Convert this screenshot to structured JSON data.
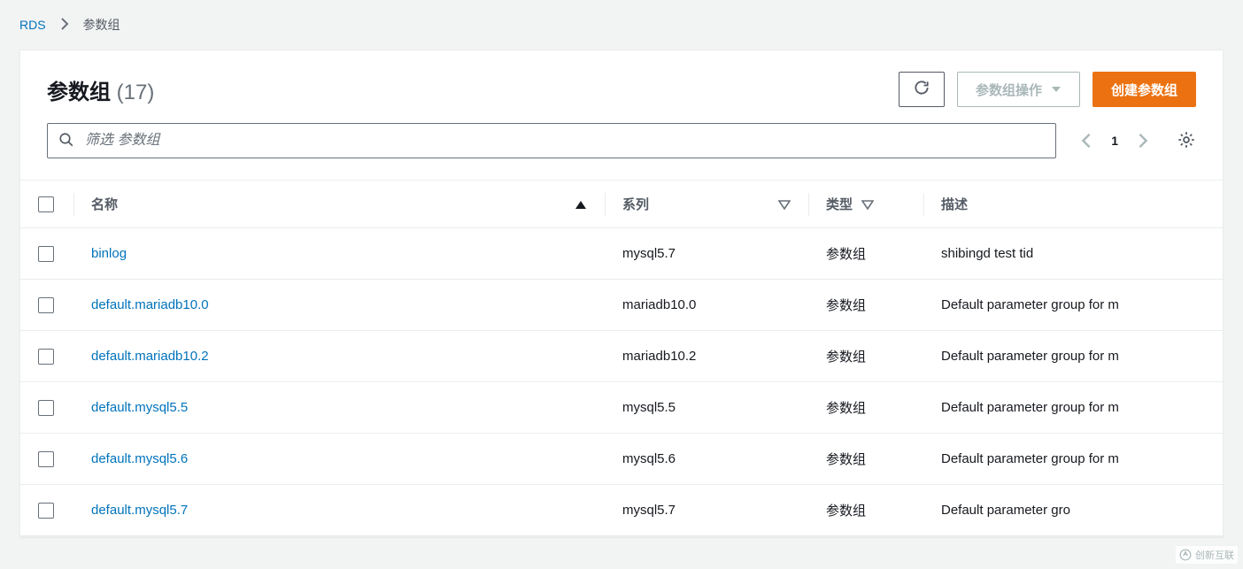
{
  "breadcrumb": {
    "root": "RDS",
    "current": "参数组"
  },
  "header": {
    "title": "参数组",
    "count": "(17)"
  },
  "buttons": {
    "refresh_aria": "刷新",
    "actions": "参数组操作",
    "create": "创建参数组"
  },
  "search": {
    "placeholder": "筛选 参数组"
  },
  "pager": {
    "page": "1"
  },
  "columns": {
    "name": "名称",
    "series": "系列",
    "type": "类型",
    "desc": "描述"
  },
  "rows": [
    {
      "name": "binlog",
      "series": "mysql5.7",
      "type": "参数组",
      "desc": "shibingd test tid"
    },
    {
      "name": "default.mariadb10.0",
      "series": "mariadb10.0",
      "type": "参数组",
      "desc": "Default parameter group for m"
    },
    {
      "name": "default.mariadb10.2",
      "series": "mariadb10.2",
      "type": "参数组",
      "desc": "Default parameter group for m"
    },
    {
      "name": "default.mysql5.5",
      "series": "mysql5.5",
      "type": "参数组",
      "desc": "Default parameter group for m"
    },
    {
      "name": "default.mysql5.6",
      "series": "mysql5.6",
      "type": "参数组",
      "desc": "Default parameter group for m"
    },
    {
      "name": "default.mysql5.7",
      "series": "mysql5.7",
      "type": "参数组",
      "desc": "Default parameter gro"
    }
  ],
  "watermark": "创新互联"
}
